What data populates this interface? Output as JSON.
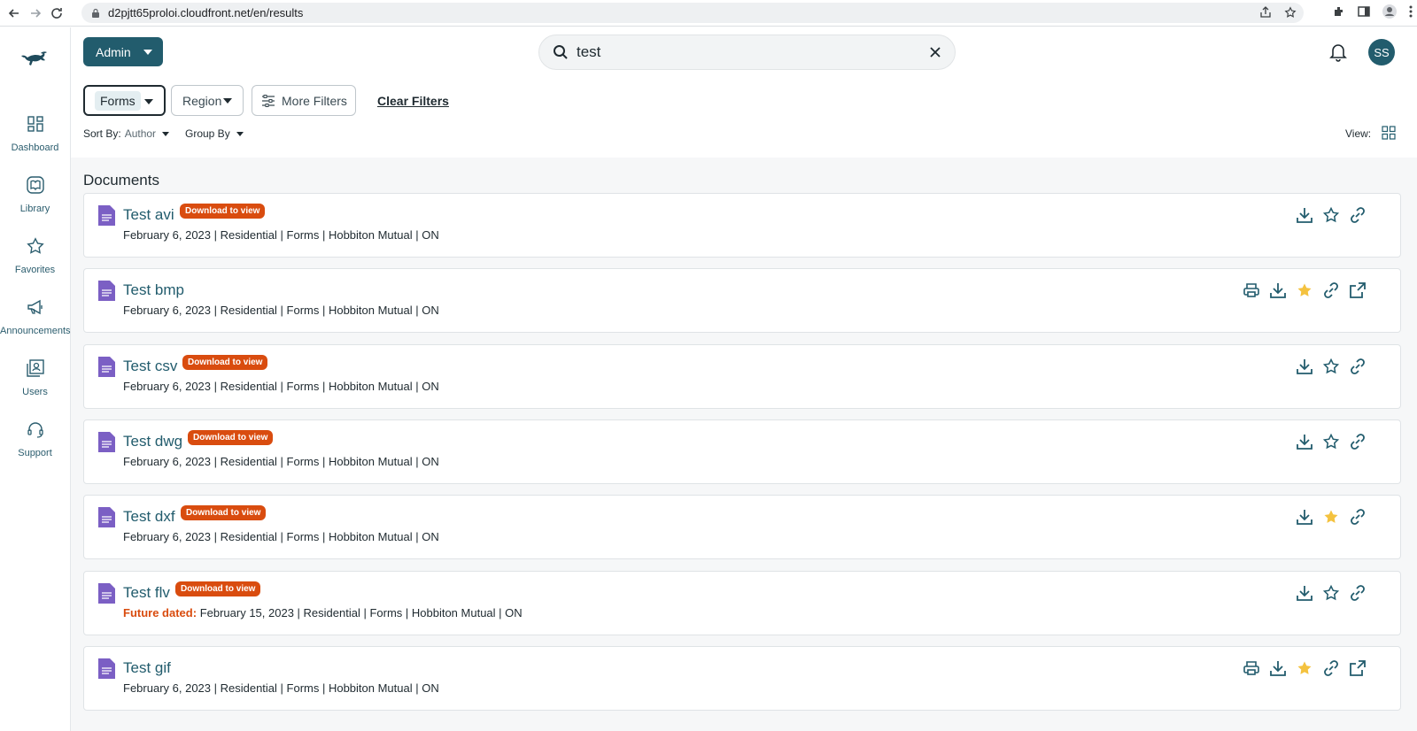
{
  "browser": {
    "url": "d2pjtt65proloi.cloudfront.net/en/results"
  },
  "sidebar": {
    "items": [
      {
        "label": "Dashboard",
        "icon": "dashboard-icon"
      },
      {
        "label": "Library",
        "icon": "library-icon"
      },
      {
        "label": "Favorites",
        "icon": "star-icon"
      },
      {
        "label": "Announcements",
        "icon": "megaphone-icon"
      },
      {
        "label": "Users",
        "icon": "users-icon"
      },
      {
        "label": "Support",
        "icon": "headset-icon"
      }
    ]
  },
  "header": {
    "admin_label": "Admin",
    "search_value": "test",
    "avatar_initials": "SS"
  },
  "filters": {
    "forms_label": "Forms",
    "region_label": "Region",
    "more_label": "More Filters",
    "clear_label": "Clear Filters",
    "sort_label": "Sort By:",
    "sort_value": "Author",
    "group_label": "Group By",
    "view_label": "View:"
  },
  "section_title": "Documents",
  "documents": [
    {
      "title": "Test avi",
      "badge": "Download to view",
      "meta": "February 6, 2023 | Residential | Forms | Hobbiton Mutual | ON",
      "future": "",
      "actions": [
        "download",
        "star",
        "link"
      ],
      "starred": false
    },
    {
      "title": "Test bmp",
      "badge": "",
      "meta": "February 6, 2023 | Residential | Forms | Hobbiton Mutual | ON",
      "future": "",
      "actions": [
        "print",
        "download",
        "star",
        "link",
        "open"
      ],
      "starred": true
    },
    {
      "title": "Test csv",
      "badge": "Download to view",
      "meta": "February 6, 2023 | Residential | Forms | Hobbiton Mutual | ON",
      "future": "",
      "actions": [
        "download",
        "star",
        "link"
      ],
      "starred": false
    },
    {
      "title": "Test dwg",
      "badge": "Download to view",
      "meta": "February 6, 2023 | Residential | Forms | Hobbiton Mutual | ON",
      "future": "",
      "actions": [
        "download",
        "star",
        "link"
      ],
      "starred": false
    },
    {
      "title": "Test dxf",
      "badge": "Download to view",
      "meta": "February 6, 2023 | Residential | Forms | Hobbiton Mutual | ON",
      "future": "",
      "actions": [
        "download",
        "star",
        "link"
      ],
      "starred": true
    },
    {
      "title": "Test flv",
      "badge": "Download to view",
      "meta": "February 15, 2023 | Residential | Forms | Hobbiton Mutual | ON",
      "future": "Future dated:",
      "actions": [
        "download",
        "star",
        "link"
      ],
      "starred": false
    },
    {
      "title": "Test gif",
      "badge": "",
      "meta": "February 6, 2023 | Residential | Forms | Hobbiton Mutual | ON",
      "future": "",
      "actions": [
        "print",
        "download",
        "star",
        "link",
        "open"
      ],
      "starred": true
    }
  ],
  "colors": {
    "brand": "#225c6d",
    "badge": "#d94c0f",
    "star_active": "#f4c23f",
    "file_icon": "#7b5fc4"
  }
}
